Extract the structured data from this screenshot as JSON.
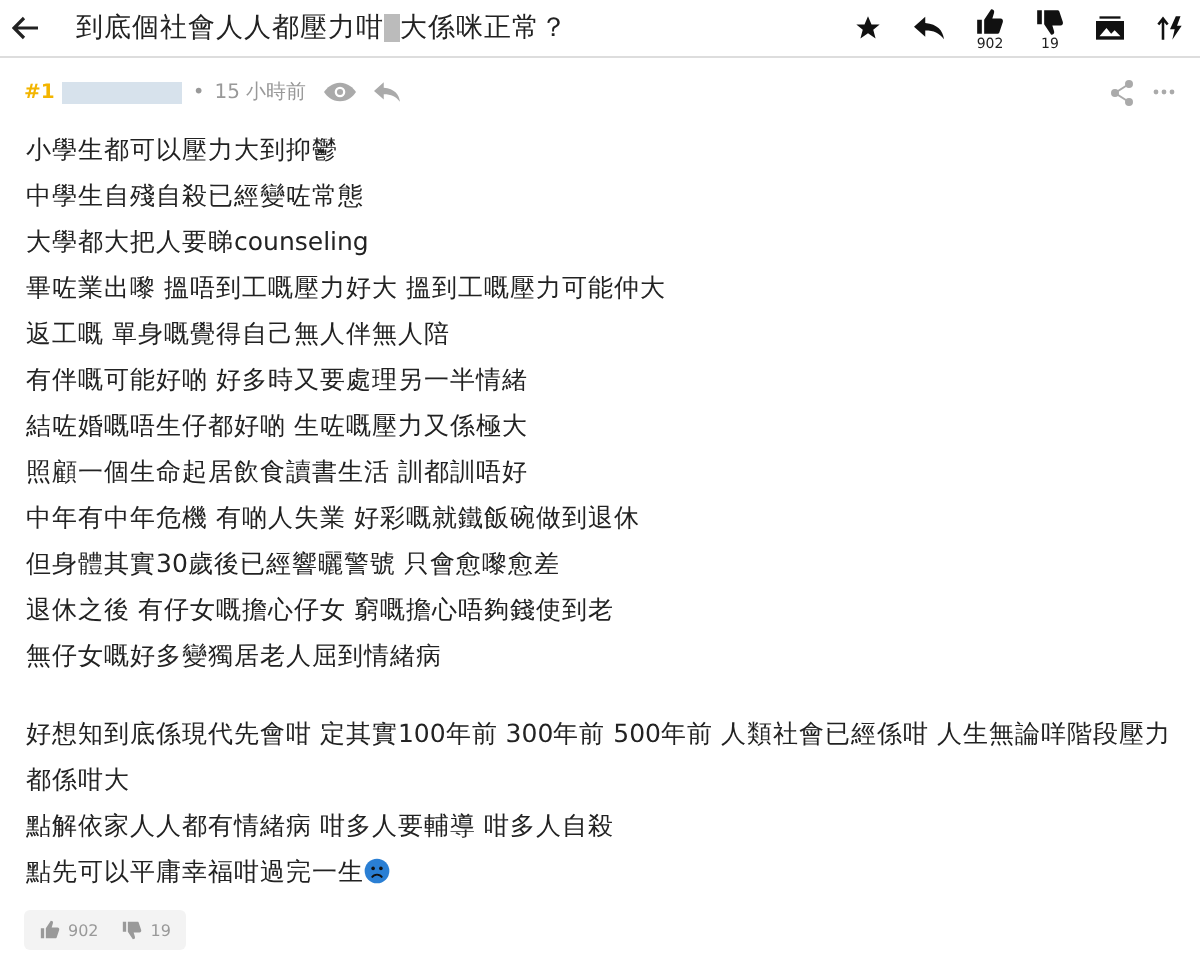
{
  "header": {
    "title_before": "到底個社會人人都壓力咁",
    "title_after": "大係咪正常？",
    "likes": "902",
    "dislikes": "19"
  },
  "post": {
    "number": "#1",
    "separator": "•",
    "time": "15 小時前",
    "paragraphs": [
      {
        "lines": [
          "小學生都可以壓力大到抑鬱",
          "中學生自殘自殺已經變咗常態",
          "大學都大把人要睇counseling",
          "畢咗業出嚟 搵唔到工嘅壓力好大 搵到工嘅壓力可能仲大",
          "返工嘅 單身嘅覺得自己無人伴無人陪",
          "有伴嘅可能好啲 好多時又要處理另一半情緒",
          "結咗婚嘅唔生仔都好啲 生咗嘅壓力又係極大",
          "照顧一個生命起居飲食讀書生活 訓都訓唔好",
          "中年有中年危機 有啲人失業 好彩嘅就鐵飯碗做到退休",
          "但身體其實30歲後已經響曬警號 只會愈嚟愈差",
          "退休之後 有仔女嘅擔心仔女 窮嘅擔心唔夠錢使到老",
          "無仔女嘅好多變獨居老人屈到情緒病"
        ]
      },
      {
        "lines": [
          "好想知到底係現代先會咁 定其實100年前 300年前 500年前 人類社會已經係咁 人生無論咩階段壓力都係咁大",
          "點解依家人人都有情緒病 咁多人要輔導 咁多人自殺",
          "點先可以平庸幸福咁過完一生"
        ]
      }
    ],
    "likes": "902",
    "dislikes": "19"
  }
}
